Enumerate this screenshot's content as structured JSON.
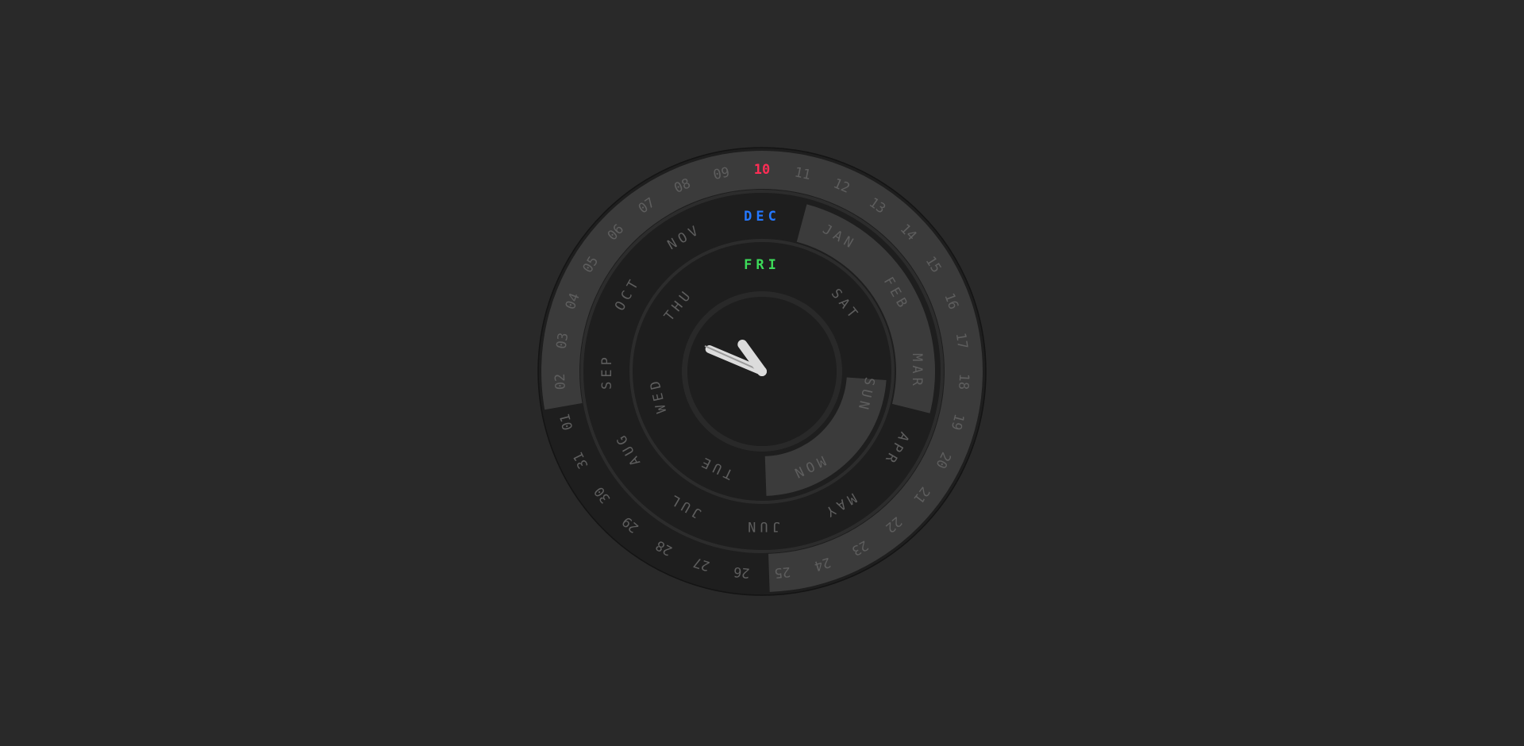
{
  "clock": {
    "days_of_month": [
      "01",
      "02",
      "03",
      "04",
      "05",
      "06",
      "07",
      "08",
      "09",
      "10",
      "11",
      "12",
      "13",
      "14",
      "15",
      "16",
      "17",
      "18",
      "19",
      "20",
      "21",
      "22",
      "23",
      "24",
      "25",
      "26",
      "27",
      "28",
      "29",
      "30",
      "31"
    ],
    "months": [
      "JAN",
      "FEB",
      "MAR",
      "APR",
      "MAY",
      "JUN",
      "JUL",
      "AUG",
      "SEP",
      "OCT",
      "NOV",
      "DEC"
    ],
    "weekdays": [
      "SUN",
      "MON",
      "TUE",
      "WED",
      "THU",
      "FRI",
      "SAT"
    ],
    "current": {
      "day_of_month": "10",
      "month": "DEC",
      "weekday": "FRI",
      "hour": 10,
      "minute": 48,
      "second": 49
    },
    "colors": {
      "background": "#292929",
      "ring_dark": "#1e1e1e",
      "ring_overlay": "#3b3b3b",
      "label_dim": "#5e5e5e",
      "day_highlight": "#ff2d55",
      "month_highlight": "#2478ff",
      "weekday_highlight": "#3ddc5a",
      "hand_color": "#dcdcdc",
      "second_hand_color": "#9a9a9a"
    }
  }
}
